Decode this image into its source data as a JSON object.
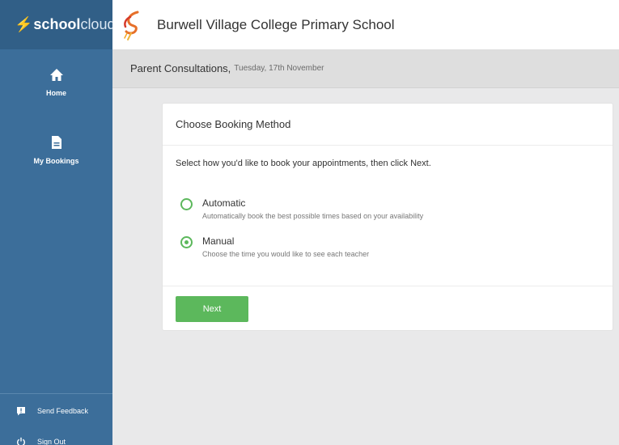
{
  "brand": {
    "bolt": "⚡",
    "part1": "school",
    "part2": "cloud"
  },
  "header": {
    "school_name": "Burwell Village College Primary School"
  },
  "subheader": {
    "event": "Parent Consultations,",
    "date": "Tuesday, 17th November"
  },
  "sidebar": {
    "items": [
      {
        "label": "Home",
        "icon": "home-icon"
      },
      {
        "label": "My Bookings",
        "icon": "document-icon"
      }
    ],
    "bottom": [
      {
        "label": "Send Feedback",
        "icon": "feedback-icon"
      },
      {
        "label": "Sign Out",
        "icon": "power-icon"
      }
    ]
  },
  "card": {
    "title": "Choose Booking Method",
    "instruction": "Select how you'd like to book your appointments, then click Next.",
    "options": [
      {
        "title": "Automatic",
        "description": "Automatically book the best possible times based on your availability",
        "selected": false
      },
      {
        "title": "Manual",
        "description": "Choose the time you would like to see each teacher",
        "selected": true
      }
    ],
    "next_label": "Next"
  },
  "colors": {
    "sidebar": "#3c6e9a",
    "brand_bar": "#315f87",
    "accent_green": "#5cb85c",
    "background": "#e9e9ea"
  }
}
